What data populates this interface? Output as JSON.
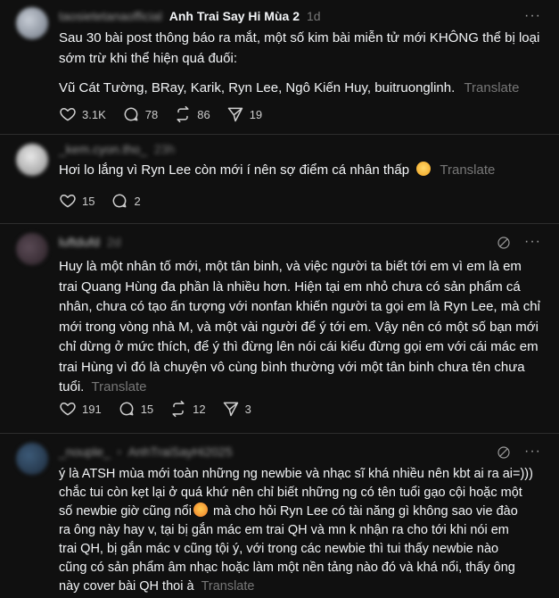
{
  "posts": [
    {
      "username": "taosietetanaofficial",
      "community": "Anh Trai Say Hi Mùa 2",
      "time": "1d",
      "lines": [
        "Sau 30 bài post thông báo ra mắt, một số kim bài miễn tử mới KHÔNG thể bị loại",
        "sớm trừ khi thể hiện quá đuối:"
      ],
      "line2": "Vũ Cát Tường, BRay, Karik, Ryn Lee, Ngô Kiến Huy, buitruonglinh.",
      "translate": "Translate",
      "likes": "3.1K",
      "comments": "78",
      "reposts": "86",
      "shares": "19"
    },
    {
      "username": "_kem.cyon.tho_",
      "time": "23h",
      "text": "Hơi lo lắng vì Ryn Lee còn mới í nên sợ điểm cá nhân thấp",
      "translate": "Translate",
      "likes": "15",
      "comments": "2"
    },
    {
      "username": "luftdufd",
      "time": "2d",
      "lines": [
        "Huy là một nhân tố mới, một tân binh, và việc người ta biết tới em vì em là em",
        "trai Quang Hùng đa phần là nhiều hơn. Hiện tại em nhỏ chưa có sản phẩm cá",
        "nhân, chưa có tạo ấn tượng với nonfan khiến người ta gọi em là Ryn Lee, mà chỉ",
        "mới trong vòng nhà M, và một vài người để ý tới em. Vậy nên có một số bạn mới",
        "chỉ dừng ở mức thích, để ý thì đừng lên nói cái kiểu đừng gọi em với cái mác em",
        "trai Hùng vì đó là chuyện vô cùng bình thường với một tân binh chưa tên chưa"
      ],
      "last_line": "tuổi.",
      "translate": "Translate",
      "likes": "191",
      "comments": "15",
      "reposts": "12",
      "shares": "3"
    },
    {
      "username": "_nouple_",
      "chevron": "›",
      "community": "AnhTraiSayHi2025",
      "lines": [
        "ý là ATSH mùa mới toàn những ng newbie và nhạc sĩ khá nhiều nên kbt ai ra ai=)))",
        "chắc tui còn kẹt lại ở quá khứ nên chỉ biết những ng có tên tuổi gạo cội hoặc một"
      ],
      "line3_before": "số newbie giờ cũng nổi",
      "line3_after": " mà cho hỏi Ryn Lee có tài năng gì không sao vie đào",
      "lines_more": [
        "ra ông này hay v, tại bị gắn mác em trai QH và mn k nhận ra cho tới khi nói em",
        "trai QH, bị gắn mác v cũng tội ý, với trong các newbie thì tui thấy newbie nào",
        "cũng có sản phẩm âm nhạc hoặc làm một nền tảng nào đó và khá nổi, thấy ông"
      ],
      "last_line": "này cover bài QH thoi à",
      "translate": "Translate"
    }
  ],
  "icons": {
    "like": "heart-icon",
    "comment": "comment-bubble-icon",
    "repost": "repost-icon",
    "share": "send-icon",
    "more": "more-options-icon",
    "mute": "hide-eye-icon"
  },
  "more_glyph": "···",
  "colors": {
    "background": "#101010",
    "text": "#f3f5f7",
    "muted": "#777777",
    "divider": "#2d2d2d"
  }
}
